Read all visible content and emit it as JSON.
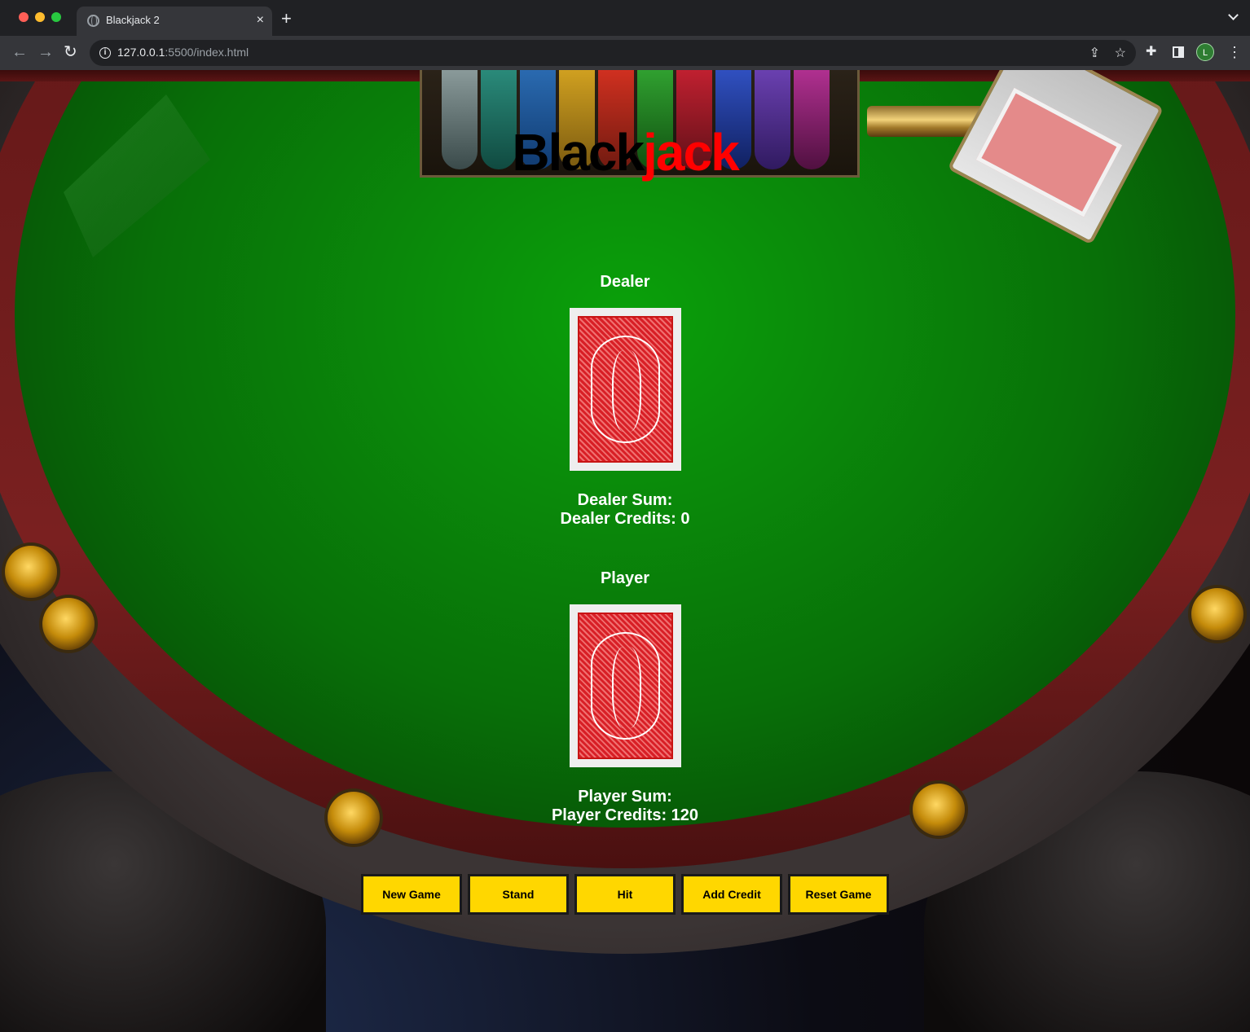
{
  "browser": {
    "tab_title": "Blackjack 2",
    "tab_close": "×",
    "new_tab": "+",
    "url_host": "127.0.0.1",
    "url_rest": ":5500/index.html",
    "profile_initial": "L"
  },
  "game": {
    "title_part1": "Black",
    "title_part2": "jack",
    "dealer_label": "Dealer",
    "dealer_sum_label": "Dealer Sum:",
    "dealer_credits_label": "Dealer Credits: 0",
    "player_label": "Player",
    "player_sum_label": "Player Sum:",
    "player_credits_label": "Player Credits: 120"
  },
  "buttons": {
    "new_game": "New Game",
    "stand": "Stand",
    "hit": "Hit",
    "add_credit": "Add Credit",
    "reset_game": "Reset Game"
  },
  "colors": {
    "button_bg": "#ffd700",
    "title_red": "#ff0000",
    "felt": "#0a8a0a"
  }
}
